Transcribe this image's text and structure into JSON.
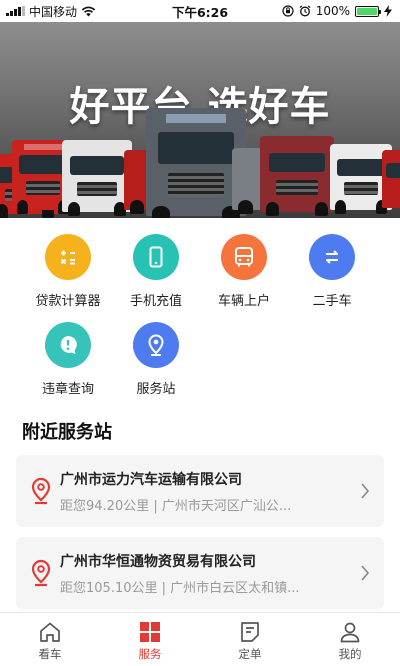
{
  "status_bar": {
    "carrier": "中国移动",
    "time": "下午6:26",
    "battery": "100%",
    "battery_level": 1.0
  },
  "banner": {
    "title": "好平台 选好车"
  },
  "services": [
    {
      "label": "贷款计算器",
      "icon": "calculator-icon",
      "color": "#f5b21c"
    },
    {
      "label": "手机充值",
      "icon": "phone-icon",
      "color": "#27c2b3"
    },
    {
      "label": "车辆上户",
      "icon": "bus-icon",
      "color": "#f4743b"
    },
    {
      "label": "二手车",
      "icon": "exchange-icon",
      "color": "#4f7bf0"
    },
    {
      "label": "违章查询",
      "icon": "alert-bubble-icon",
      "color": "#36c3b9"
    },
    {
      "label": "服务站",
      "icon": "location-icon",
      "color": "#4f7bf0"
    }
  ],
  "nearby": {
    "title": "附近服务站",
    "stations": [
      {
        "name": "广州市运力汽车运输有限公司",
        "detail": "距您94.20公里 | 广州市天河区广汕公..."
      },
      {
        "name": "广州市华恒通物资贸易有限公司",
        "detail": "距您105.10公里 | 广州市白云区太和镇..."
      }
    ]
  },
  "tabbar": {
    "active": 1,
    "accent": "#e53935",
    "tabs": [
      {
        "label": "看车",
        "icon": "home-icon"
      },
      {
        "label": "服务",
        "icon": "grid-icon"
      },
      {
        "label": "定单",
        "icon": "order-icon"
      },
      {
        "label": "我的",
        "icon": "user-icon"
      }
    ]
  }
}
